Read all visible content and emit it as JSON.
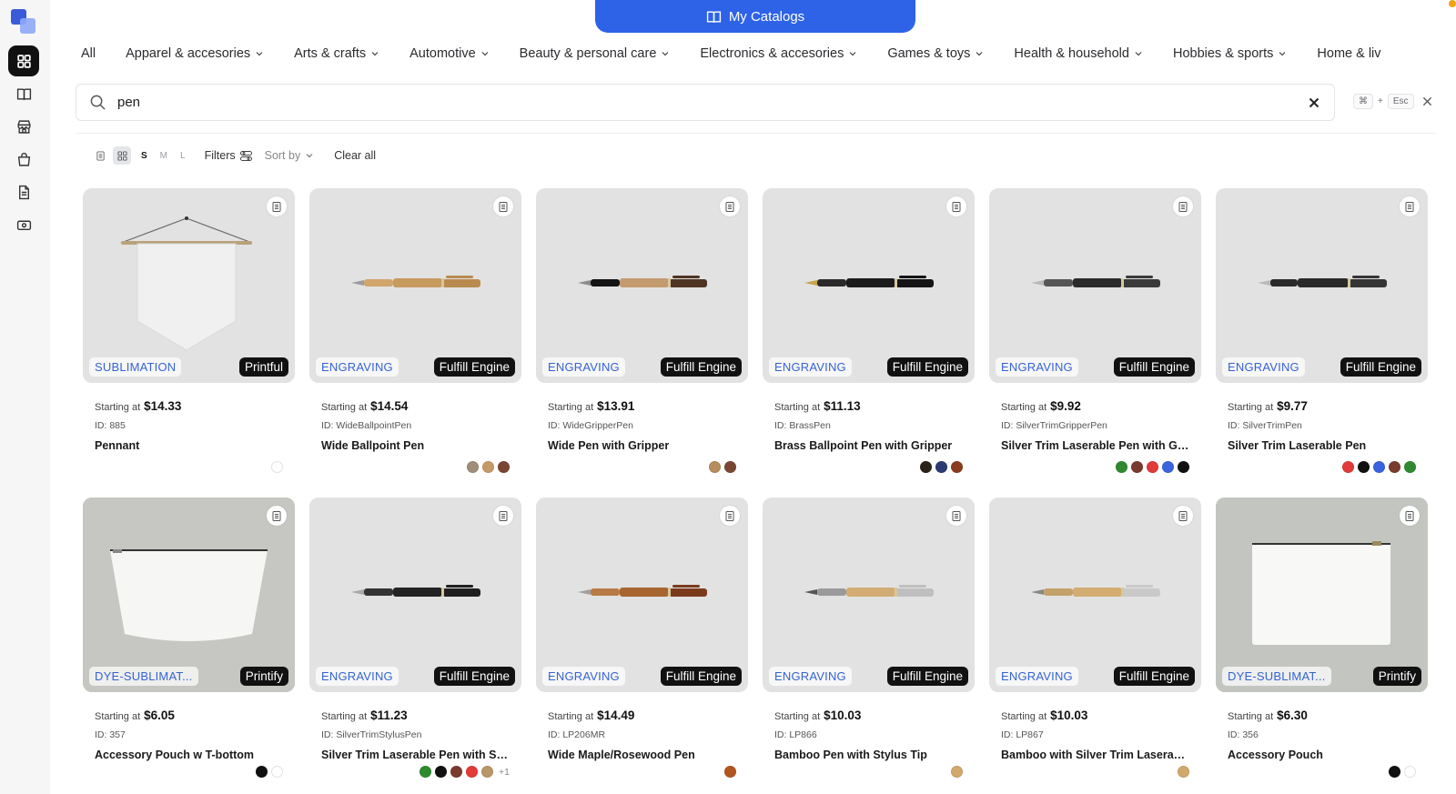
{
  "header": {
    "catalogs_label": "My Catalogs"
  },
  "categories": [
    "All",
    "Apparel & accesories",
    "Arts & crafts",
    "Automotive",
    "Beauty & personal care",
    "Electronics & accesories",
    "Games & toys",
    "Health & household",
    "Hobbies & sports",
    "Home & liv"
  ],
  "search": {
    "value": "pen",
    "shortcut_cmd": "⌘",
    "shortcut_plus": "+",
    "shortcut_esc": "Esc"
  },
  "toolbar": {
    "size_s": "S",
    "size_m": "M",
    "size_l": "L",
    "filters": "Filters",
    "sort": "Sort by",
    "clear": "Clear all"
  },
  "price_prefix": "Starting at",
  "products": [
    {
      "tech": "SUBLIMATION",
      "provider": "Printful",
      "price": "$14.33",
      "id": "ID: 885",
      "name": "Pennant",
      "art": "pennant",
      "colors": [
        "#ffffff"
      ]
    },
    {
      "tech": "ENGRAVING",
      "provider": "Fulfill Engine",
      "price": "$14.54",
      "id": "ID: WideBallpointPen",
      "name": "Wide Ballpoint Pen",
      "art": "pen-wood",
      "colors": [
        "#a08e78",
        "#c49a68",
        "#7a4634"
      ]
    },
    {
      "tech": "ENGRAVING",
      "provider": "Fulfill Engine",
      "price": "$13.91",
      "id": "ID: WideGripperPen",
      "name": "Wide Pen with Gripper",
      "art": "pen-grip",
      "colors": [
        "#b78d5d",
        "#7a4634"
      ]
    },
    {
      "tech": "ENGRAVING",
      "provider": "Fulfill Engine",
      "price": "$11.13",
      "id": "ID: BrassPen",
      "name": "Brass Ballpoint Pen with Gripper",
      "art": "pen-brass",
      "colors": [
        "#2b2218",
        "#2a3a74",
        "#8a3d1e"
      ]
    },
    {
      "tech": "ENGRAVING",
      "provider": "Fulfill Engine",
      "price": "$9.92",
      "id": "ID: SilverTrimGripperPen",
      "name": "Silver Trim Laserable Pen with Gri...",
      "art": "pen-black",
      "colors": [
        "#2f8a2f",
        "#7a3a2e",
        "#e23a3a",
        "#3a63e0",
        "#111111"
      ]
    },
    {
      "tech": "ENGRAVING",
      "provider": "Fulfill Engine",
      "price": "$9.77",
      "id": "ID: SilverTrimPen",
      "name": "Silver Trim Laserable Pen",
      "art": "pen-black2",
      "colors": [
        "#e23a3a",
        "#111111",
        "#3a63e0",
        "#7a3a2e",
        "#2f8a2f"
      ]
    },
    {
      "tech": "DYE-SUBLIMAT...",
      "provider": "Printify",
      "price": "$6.05",
      "id": "ID: 357",
      "name": "Accessory Pouch w T-bottom",
      "art": "pouch-t",
      "colors": [
        "#111111",
        "#ffffff"
      ]
    },
    {
      "tech": "ENGRAVING",
      "provider": "Fulfill Engine",
      "price": "$11.23",
      "id": "ID: SilverTrimStylusPen",
      "name": "Silver Trim Laserable Pen with Sty...",
      "art": "pen-stylus",
      "colors": [
        "#2f8a2f",
        "#111111",
        "#7a3a2e",
        "#e23a3a",
        "#b99668"
      ],
      "more": "+1"
    },
    {
      "tech": "ENGRAVING",
      "provider": "Fulfill Engine",
      "price": "$14.49",
      "id": "ID: LP206MR",
      "name": "Wide Maple/Rosewood Pen",
      "art": "pen-rose",
      "colors": [
        "#b2551f"
      ]
    },
    {
      "tech": "ENGRAVING",
      "provider": "Fulfill Engine",
      "price": "$10.03",
      "id": "ID: LP866",
      "name": "Bamboo Pen with Stylus Tip",
      "art": "pen-bamboo",
      "colors": [
        "#d3a86b"
      ]
    },
    {
      "tech": "ENGRAVING",
      "provider": "Fulfill Engine",
      "price": "$10.03",
      "id": "ID: LP867",
      "name": "Bamboo with Silver Trim Laserable ...",
      "art": "pen-bamboo2",
      "colors": [
        "#d3a86b"
      ]
    },
    {
      "tech": "DYE-SUBLIMAT...",
      "provider": "Printify",
      "price": "$6.30",
      "id": "ID: 356",
      "name": "Accessory Pouch",
      "art": "pouch",
      "colors": [
        "#111111",
        "#ffffff"
      ]
    }
  ]
}
